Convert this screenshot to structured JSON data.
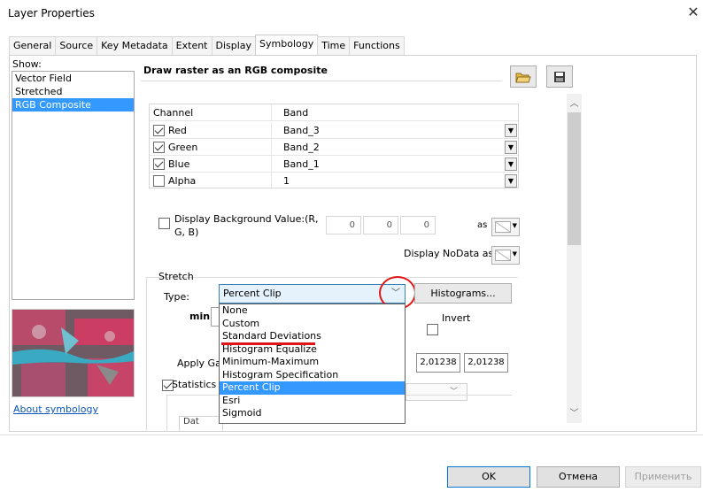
{
  "window": {
    "title": "Layer Properties"
  },
  "tabs": [
    "General",
    "Source",
    "Key Metadata",
    "Extent",
    "Display",
    "Symbology",
    "Time",
    "Functions"
  ],
  "active_tab": "Symbology",
  "show": {
    "label": "Show:",
    "items": [
      "Vector Field",
      "Stretched",
      "RGB Composite"
    ],
    "selected": "RGB Composite"
  },
  "about_link": "About symbology",
  "heading": "Draw raster as an RGB composite",
  "channels": {
    "header_channel": "Channel",
    "header_band": "Band",
    "rows": [
      {
        "channel": "Red",
        "band": "Band_3",
        "checked": true
      },
      {
        "channel": "Green",
        "band": "Band_2",
        "checked": true
      },
      {
        "channel": "Blue",
        "band": "Band_1",
        "checked": true
      },
      {
        "channel": "Alpha",
        "band": "1",
        "checked": false
      }
    ]
  },
  "background": {
    "label": "Display Background Value:(R, G, B)",
    "values": [
      "0",
      "0",
      "0"
    ],
    "as_label": "as",
    "checked": false
  },
  "nodata": {
    "label": "Display NoData as"
  },
  "stretch": {
    "group_label": "Stretch",
    "type_label": "Type:",
    "type_value": "Percent Clip",
    "histograms_button": "Histograms...",
    "min_label": "min:",
    "invert_label": "Invert",
    "invert_checked": false,
    "apply_gamma_label": "Apply Ga",
    "apply_gamma_checked": true,
    "gamma_values": [
      "2,01238",
      "2,01238"
    ],
    "statistics_label": "Statistics",
    "cut_text": "Dat",
    "options": [
      "None",
      "Custom",
      "Standard Deviations",
      "Histogram Equalize",
      "Minimum-Maximum",
      "Histogram Specification",
      "Percent Clip",
      "Esri",
      "Sigmoid"
    ],
    "selected_option": "Percent Clip",
    "highlighted_option": "Standard Deviations"
  },
  "footer": {
    "ok": "OK",
    "cancel": "Отмена",
    "apply": "Применить"
  },
  "colors": {
    "selection": "#3399ff",
    "annotation": "#e01515",
    "link": "#0b57b8"
  }
}
